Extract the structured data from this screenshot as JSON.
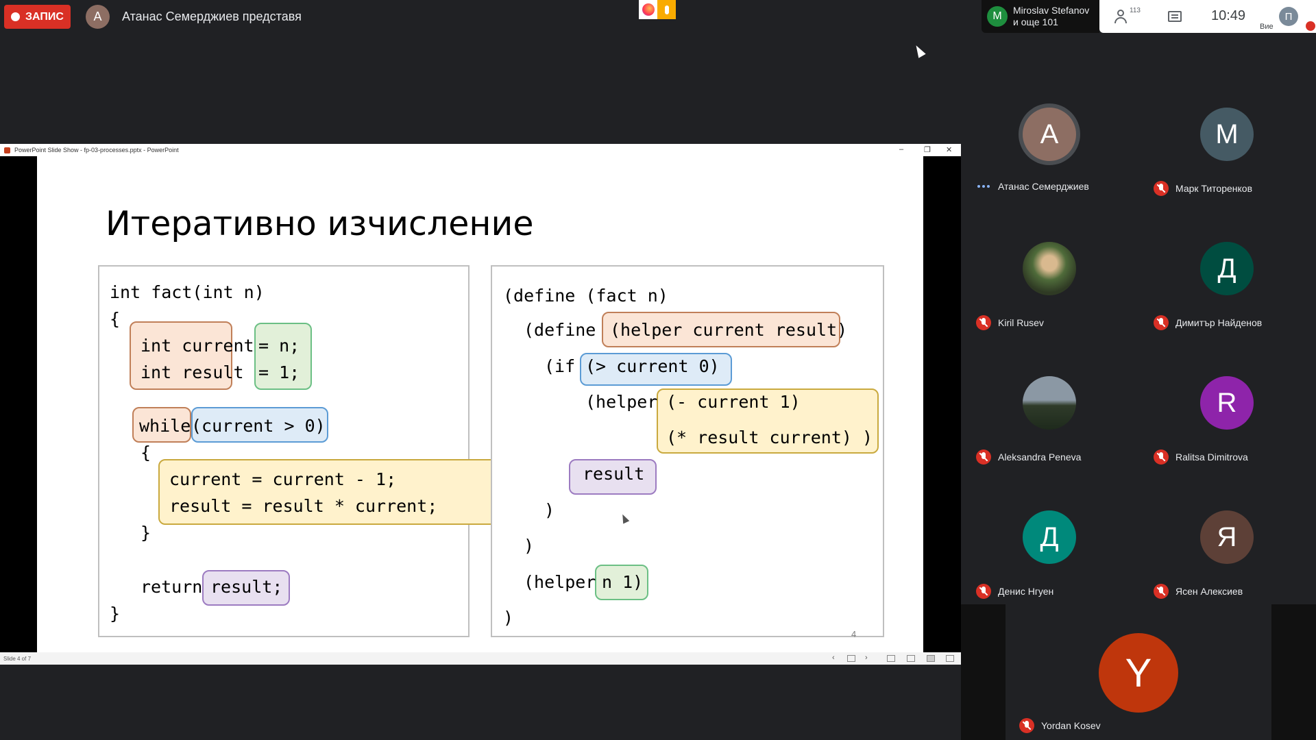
{
  "top_bar": {
    "record_label": "ЗАПИС",
    "presenter_initial": "А",
    "presenter_text": "Атанас Семерджиев представя"
  },
  "pinned": {
    "initial": "M",
    "line1": "Miroslav Stefanov",
    "line2": "и още 101"
  },
  "controls": {
    "participants_count": "113",
    "time": "10:49",
    "me_initial": "П",
    "me_label": "Вие"
  },
  "ppt_window": {
    "title": "PowerPoint Slide Show - fp-03-processes.pptx - PowerPoint",
    "status": "Slide 4 of 7",
    "minimize": "–",
    "restore": "❐",
    "close": "✕"
  },
  "slide": {
    "title": "Итеративно изчисление",
    "number": "4",
    "c_code": {
      "l1": "int fact(int n)",
      "l2": "{",
      "l3a": "int current",
      "l3b": "= n;",
      "l4a": "int result",
      "l4b": "= 1;",
      "l5a": "while",
      "l5b": "(current > 0)",
      "l6": "{",
      "l7": "current = current - 1;",
      "l8": "result = result * current;",
      "l9": "}",
      "l10a": "return",
      "l10b": "result;",
      "l11": "}"
    },
    "scheme_code": {
      "l1": "(define (fact n)",
      "l2a": "(define",
      "l2b": "(helper current result)",
      "l3a": "(if",
      "l3b": "(> current 0)",
      "l4a": "(helper",
      "l4b": "(- current 1)",
      "l5": "(* result current) )",
      "l6": "result",
      "l7": ")",
      "l8": ")",
      "l9a": "(helper",
      "l9b": "n 1)",
      "l10": ")"
    }
  },
  "participants": [
    {
      "name": "Атанас Семерджиев",
      "initial": "А",
      "color": "#8d6e63",
      "muted": false
    },
    {
      "name": "Марк Титоренков",
      "initial": "M",
      "color": "#455a64",
      "muted": true
    },
    {
      "name": "Kiril Rusev",
      "initial": "",
      "color": "#5d4037",
      "muted": true
    },
    {
      "name": "Димитър Найденов",
      "initial": "Д",
      "color": "#004d40",
      "muted": true
    },
    {
      "name": "Aleksandra Peneva",
      "initial": "",
      "color": "#37474f",
      "muted": true
    },
    {
      "name": "Ralitsa Dimitrova",
      "initial": "R",
      "color": "#8e24aa",
      "muted": true
    },
    {
      "name": "Денис Нгуен",
      "initial": "Д",
      "color": "#00897b",
      "muted": true
    },
    {
      "name": "Ясен Алексиев",
      "initial": "Я",
      "color": "#5d4037",
      "muted": true
    }
  ],
  "featured": {
    "name": "Yordan Kosev",
    "initial": "Y",
    "color": "#bf360c"
  }
}
